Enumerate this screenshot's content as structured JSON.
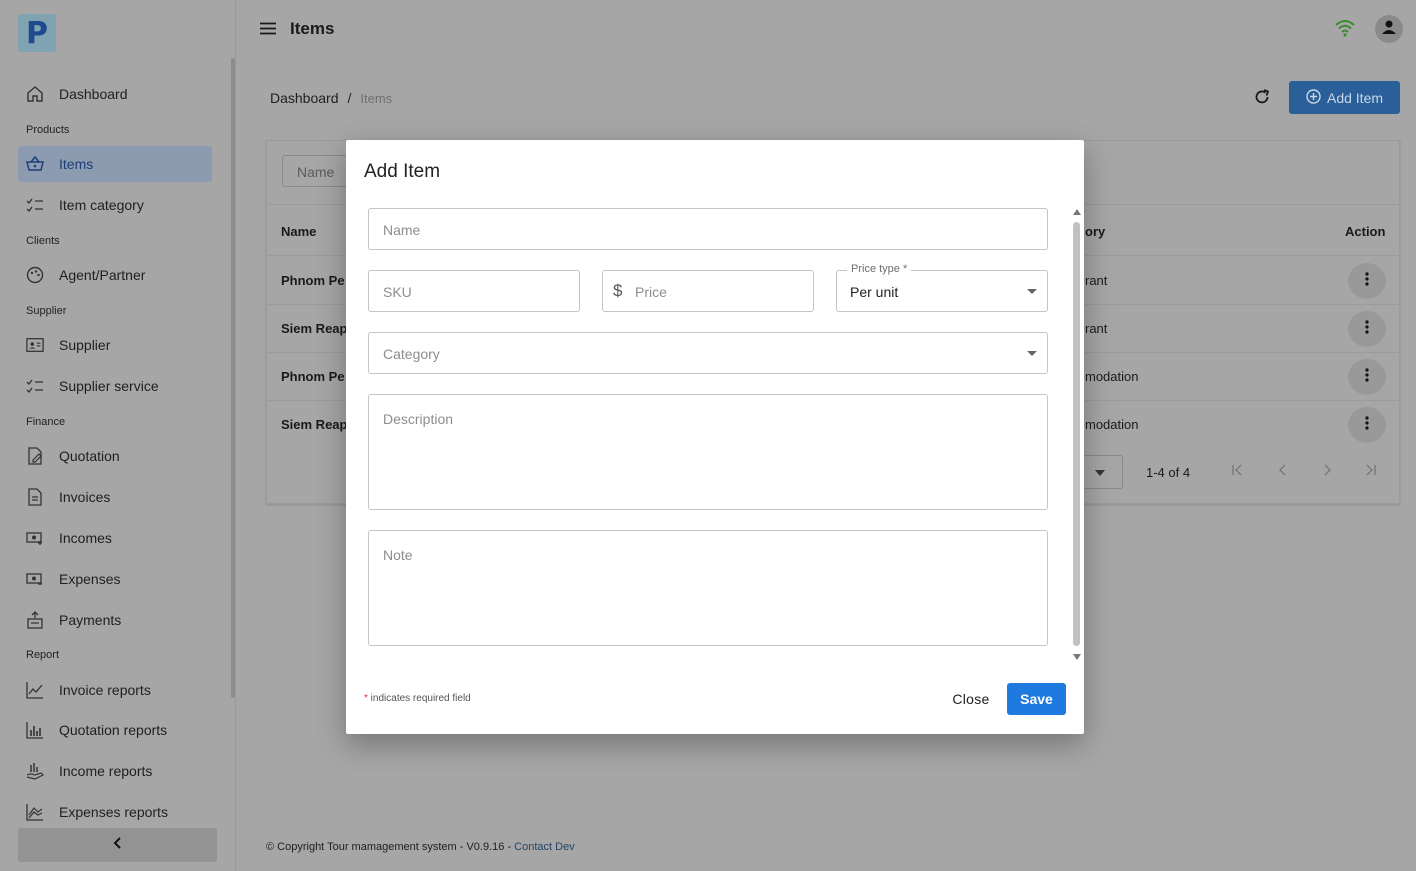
{
  "app": {
    "logo_letter": "P",
    "page_title": "Items"
  },
  "sidebar": {
    "items": [
      {
        "label": "Dashboard",
        "icon": "home-icon"
      },
      {
        "label": "Items",
        "icon": "basket-icon",
        "active": true
      },
      {
        "label": "Item category",
        "icon": "checklist-icon"
      },
      {
        "label": "Agent/Partner",
        "icon": "palette-icon"
      },
      {
        "label": "Supplier",
        "icon": "id-card-icon"
      },
      {
        "label": "Supplier service",
        "icon": "checklist-icon"
      },
      {
        "label": "Quotation",
        "icon": "edit-document-icon"
      },
      {
        "label": "Invoices",
        "icon": "document-icon"
      },
      {
        "label": "Incomes",
        "icon": "money-in-icon"
      },
      {
        "label": "Expenses",
        "icon": "money-out-icon"
      },
      {
        "label": "Payments",
        "icon": "payment-icon"
      },
      {
        "label": "Invoice reports",
        "icon": "line-chart-icon"
      },
      {
        "label": "Quotation reports",
        "icon": "bar-chart-icon"
      },
      {
        "label": "Income reports",
        "icon": "hand-chart-icon"
      },
      {
        "label": "Expenses reports",
        "icon": "stacked-line-icon"
      }
    ],
    "sections": [
      "Products",
      "Clients",
      "Supplier",
      "Finance",
      "Report"
    ]
  },
  "breadcrumb": {
    "home": "Dashboard",
    "separator": "/",
    "current": "Items"
  },
  "toolbar": {
    "add_label": "Add Item"
  },
  "table": {
    "filter_placeholder": "Name",
    "headers": {
      "name": "Name",
      "category": "ory",
      "action": "Action"
    },
    "rows": [
      {
        "name": "Phnom Pe",
        "category": "rant"
      },
      {
        "name": "Siem Reap",
        "category": "rant"
      },
      {
        "name": "Phnom Pe",
        "category": "modation"
      },
      {
        "name": "Siem Reap",
        "category": "modation"
      }
    ],
    "range": "1-4 of 4"
  },
  "footer": {
    "text": "© Copyright Tour mamagement system - V0.9.16 - ",
    "link": "Contact Dev"
  },
  "modal": {
    "title": "Add Item",
    "name_placeholder": "Name",
    "sku_placeholder": "SKU",
    "price_placeholder": "Price",
    "price_symbol": "$",
    "price_type_label": "Price type *",
    "price_type_value": "Per unit",
    "category_placeholder": "Category",
    "description_placeholder": "Description",
    "note_placeholder": "Note",
    "required_star": "*",
    "required_note": " indicates required field",
    "close_label": "Close",
    "save_label": "Save"
  },
  "colors": {
    "primary": "#1f7ae0",
    "wifi": "#3a8a2e"
  }
}
